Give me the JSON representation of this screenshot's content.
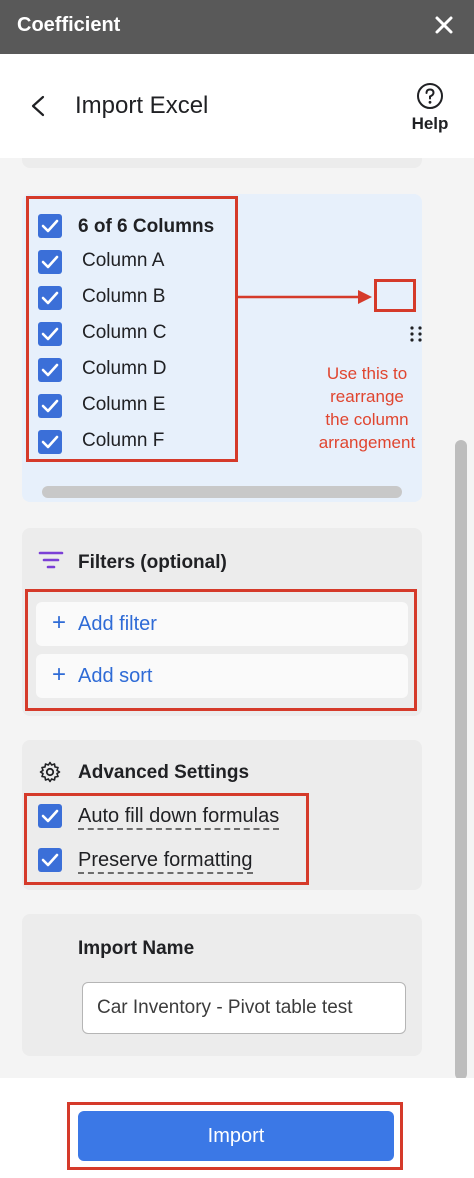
{
  "titlebar": {
    "app_name": "Coefficient"
  },
  "header": {
    "title": "Import Excel",
    "help_label": "Help"
  },
  "columns": {
    "header_label": "6 of 6 Columns",
    "items": [
      {
        "label": "Column A",
        "checked": true
      },
      {
        "label": "Column B",
        "checked": true
      },
      {
        "label": "Column C",
        "checked": true
      },
      {
        "label": "Column D",
        "checked": true
      },
      {
        "label": "Column E",
        "checked": true
      },
      {
        "label": "Column F",
        "checked": true
      }
    ]
  },
  "annotation": {
    "line1": "Use this to",
    "line2": "rearrange",
    "line3": "the column",
    "line4": "arrangement"
  },
  "filters": {
    "title": "Filters (optional)",
    "add_filter_label": "Add filter",
    "add_sort_label": "Add sort"
  },
  "advanced": {
    "title": "Advanced Settings",
    "auto_fill_label": "Auto fill down formulas",
    "preserve_label": "Preserve formatting"
  },
  "import_name": {
    "title": "Import Name",
    "value": "Car Inventory - Pivot table test"
  },
  "footer": {
    "import_label": "Import"
  },
  "colors": {
    "accent": "#3b78e6",
    "checkbox": "#3b6fd8",
    "annotation_red": "#d53a2a",
    "filter_icon": "#7b3fd6"
  }
}
